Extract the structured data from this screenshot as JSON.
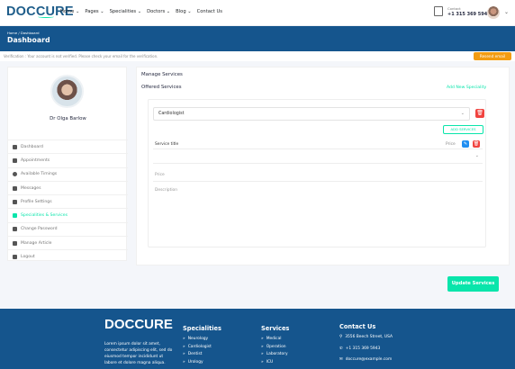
{
  "header": {
    "logo": "DOCCURE",
    "nav": [
      "Home ⌄",
      "Pages ⌄",
      "Specialities ⌄",
      "Doctors ⌄",
      "Blog ⌄",
      "Contact Us"
    ],
    "contact_label": "Contact",
    "contact_number": "+1 315 369 5943"
  },
  "breadcrumb": {
    "path": "Home / Dashboard",
    "title": "Dashboard"
  },
  "verification": {
    "text": "Verification : Your account is not verified. Please check your email for the verification.",
    "resend": "Resend email"
  },
  "sidebar": {
    "name": "Dr Olga Barlow",
    "items": [
      {
        "label": "Dashboard",
        "icon": "grid-icon"
      },
      {
        "label": "Appointments",
        "icon": "calendar-icon"
      },
      {
        "label": "Available Timings",
        "icon": "clock-icon"
      },
      {
        "label": "Messages",
        "icon": "comments-icon"
      },
      {
        "label": "Profile Settings",
        "icon": "user-cog-icon"
      },
      {
        "label": "Specialities & Services",
        "icon": "briefcase-icon",
        "active": true
      },
      {
        "label": "Change Password",
        "icon": "lock-icon"
      },
      {
        "label": "Manage Article",
        "icon": "pen-icon"
      },
      {
        "label": "Logout",
        "icon": "sign-out-icon"
      }
    ]
  },
  "main": {
    "title": "Manage Services",
    "offered": "Offered Services",
    "add_speciality": "Add New Speciality",
    "speciality_value": "Cardiologist",
    "add_service": "ADD SERVICES",
    "service_site": "Service title",
    "price_small": "Price",
    "price_placeholder": "Price",
    "description_placeholder": "Description",
    "update": "Update Services"
  },
  "footer": {
    "logo": "DOCCURE",
    "about": "Lorem ipsum dolor sit amet, consectetur adipiscing elit, sed do eiusmod tempor incididunt ut labore et dolore magna aliqua.",
    "specialities": {
      "title": "Specialities",
      "items": [
        "Neurology",
        "Cardiologist",
        "Dentist",
        "Urology"
      ]
    },
    "services": {
      "title": "Services",
      "items": [
        "Medical",
        "Operation",
        "Laboratory",
        "ICU"
      ]
    },
    "contact": {
      "title": "Contact Us",
      "address": "3556 Beech Street, USA",
      "phone": "+1 315 369 5943",
      "email": "doccure@example.com"
    }
  },
  "colors": {
    "brand": "#15558d",
    "accent": "#09e5ab",
    "danger": "#f0433f",
    "warning": "#f39c12"
  }
}
